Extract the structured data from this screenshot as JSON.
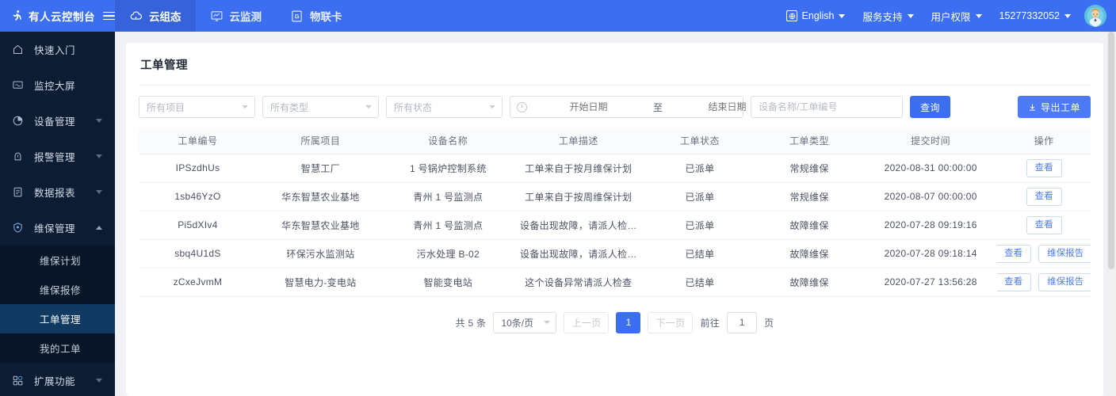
{
  "colors": {
    "brand_blue": "#3b6ef0",
    "nav_active": "#3663db",
    "sidebar_bg": "#0b1c33",
    "sidebar_sub_bg": "#071527",
    "sidebar_active": "#113a63",
    "status_green": "#52c41a",
    "link_blue": "#4c7bf5"
  },
  "topbar": {
    "logo_icon": "person-running-icon",
    "brand": "有人云控制台",
    "menu_icon": "hamburger-menu-icon",
    "nav": [
      {
        "label": "云组态",
        "icon": "cloud-icon",
        "active": true
      },
      {
        "label": "云监测",
        "icon": "monitor-chart-icon",
        "active": false
      },
      {
        "label": "物联卡",
        "icon": "sim-card-icon",
        "active": false
      }
    ],
    "right": [
      {
        "label": "English",
        "icon": "globe-icon",
        "caret": true
      },
      {
        "label": "服务支持",
        "icon": "",
        "caret": true
      },
      {
        "label": "用户权限",
        "icon": "",
        "caret": true
      },
      {
        "label": "15277332052",
        "icon": "",
        "caret": true
      }
    ],
    "avatar": "user-avatar"
  },
  "sidebar": {
    "items": [
      {
        "label": "快速入门",
        "icon": "home-icon",
        "caret": "none"
      },
      {
        "label": "监控大屏",
        "icon": "screen-icon",
        "caret": "none"
      },
      {
        "label": "设备管理",
        "icon": "pie-chart-icon",
        "caret": "down"
      },
      {
        "label": "报警管理",
        "icon": "bell-icon",
        "caret": "down"
      },
      {
        "label": "数据报表",
        "icon": "document-icon",
        "caret": "down"
      },
      {
        "label": "维保管理",
        "icon": "shield-icon",
        "caret": "up",
        "expanded": true
      }
    ],
    "submenu": [
      {
        "label": "维保计划",
        "active": false
      },
      {
        "label": "维保报修",
        "active": false
      },
      {
        "label": "工单管理",
        "active": true
      },
      {
        "label": "我的工单",
        "active": false
      }
    ],
    "bottom": {
      "label": "扩展功能",
      "icon": "grid-apps-icon",
      "caret": "down"
    }
  },
  "page": {
    "title": "工单管理"
  },
  "filters": {
    "project": "所有项目",
    "type": "所有类型",
    "status": "所有状态",
    "date_icon": "clock-icon",
    "start_date_placeholder": "开始日期",
    "date_separator": "至",
    "end_date_placeholder": "结束日期",
    "keyword_value": "",
    "keyword_placeholder": "设备名称/工单编号",
    "query_button": "查询",
    "export_button": "导出工单",
    "export_icon": "download-icon"
  },
  "table": {
    "headers": [
      "工单编号",
      "所属项目",
      "设备名称",
      "工单描述",
      "工单状态",
      "工单类型",
      "提交时间",
      "操作"
    ],
    "rows": [
      {
        "id": "IPSzdhUs",
        "project": "智慧工厂",
        "device": "1 号锅炉控制系统",
        "desc": "工单来自于按月维保计划",
        "status": "已派单",
        "status_type": "dispatched",
        "type": "常规维保",
        "time": "2020-08-31 00:00:00",
        "actions": [
          "查看"
        ]
      },
      {
        "id": "1sb46YzO",
        "project": "华东智慧农业基地",
        "device": "青州 1 号监测点",
        "desc": "工单来自于按周维保计划",
        "status": "已派单",
        "status_type": "dispatched",
        "type": "常规维保",
        "time": "2020-08-07 00:00:00",
        "actions": [
          "查看"
        ]
      },
      {
        "id": "Pi5dXIv4",
        "project": "华东智慧农业基地",
        "device": "青州 1 号监测点",
        "desc": "设备出现故障，请派人检…",
        "status": "已派单",
        "status_type": "dispatched",
        "type": "故障维保",
        "time": "2020-07-28 09:19:16",
        "actions": [
          "查看"
        ]
      },
      {
        "id": "sbq4U1dS",
        "project": "环保污水监测站",
        "device": "污水处理 B-02",
        "desc": "设备出现故障，请派人检…",
        "status": "已结单",
        "status_type": "closed",
        "type": "故障维保",
        "time": "2020-07-28 09:18:14",
        "actions": [
          "查看",
          "维保报告"
        ]
      },
      {
        "id": "zCxeJvmM",
        "project": "智慧电力-变电站",
        "device": "智能变电站",
        "desc": "这个设备异常请派人检查",
        "status": "已结单",
        "status_type": "closed",
        "type": "故障维保",
        "time": "2020-07-27 13:56:28",
        "actions": [
          "查看",
          "维保报告"
        ]
      }
    ]
  },
  "pagination": {
    "total_text": "共 5 条",
    "page_size": "10条/页",
    "prev": "上一页",
    "current_page": "1",
    "next": "下一页",
    "goto_label": "前往",
    "goto_value": "1",
    "goto_suffix": "页"
  }
}
